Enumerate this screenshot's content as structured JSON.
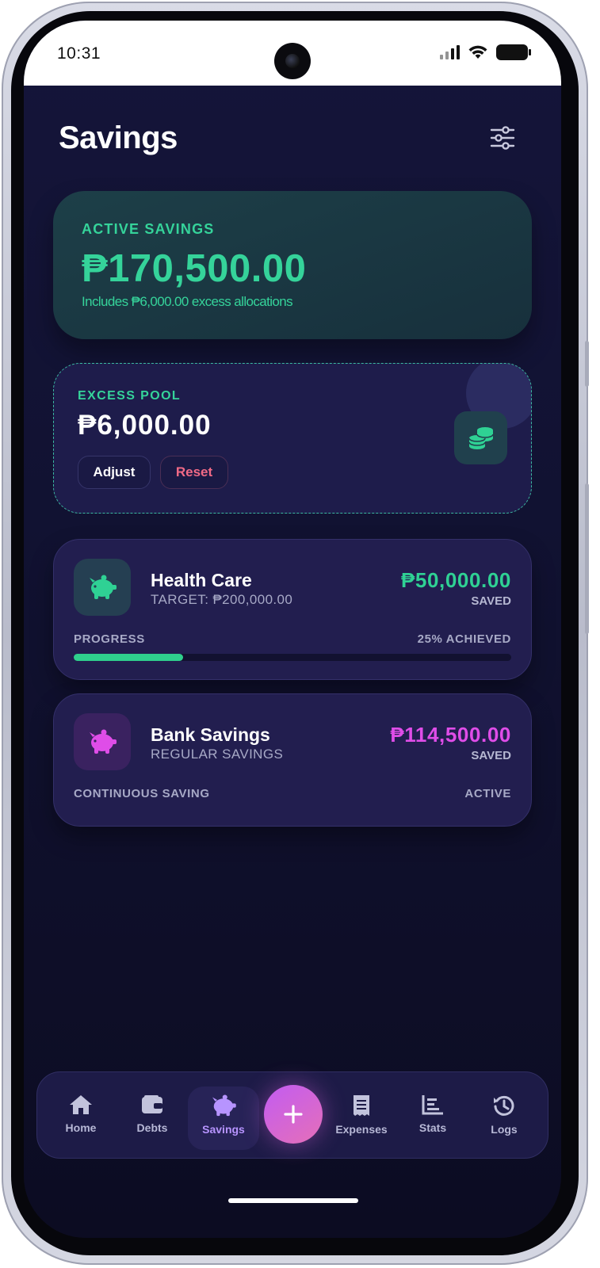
{
  "status_bar": {
    "time": "10:31"
  },
  "header": {
    "title": "Savings",
    "filter_icon": "sliders-icon"
  },
  "active_savings": {
    "label": "ACTIVE SAVINGS",
    "amount": "₱170,500.00",
    "note": "Includes ₱6,000.00 excess allocations"
  },
  "excess_pool": {
    "label": "EXCESS POOL",
    "amount": "₱6,000.00",
    "adjust_label": "Adjust",
    "reset_label": "Reset",
    "icon": "coins-icon"
  },
  "goals": [
    {
      "name": "Health Care",
      "subtitle": "TARGET: ₱200,000.00",
      "amount": "₱50,000.00",
      "saved_label": "SAVED",
      "footer_left": "PROGRESS",
      "footer_right": "25% ACHIEVED",
      "progress_percent": 25,
      "icon": "piggy-bank-icon",
      "color": "#2fd194"
    },
    {
      "name": "Bank Savings",
      "subtitle": "REGULAR SAVINGS",
      "amount": "₱114,500.00",
      "saved_label": "SAVED",
      "footer_left": "CONTINUOUS SAVING",
      "footer_right": "ACTIVE",
      "icon": "piggy-bank-icon",
      "color": "#df4de8"
    }
  ],
  "bottom_nav": {
    "items": [
      {
        "label": "Home",
        "icon": "home-icon"
      },
      {
        "label": "Debts",
        "icon": "wallet-icon"
      },
      {
        "label": "Savings",
        "icon": "piggy-bank-icon",
        "active": true
      },
      {
        "label": "Expenses",
        "icon": "receipt-icon"
      },
      {
        "label": "Stats",
        "icon": "stats-icon"
      },
      {
        "label": "Logs",
        "icon": "history-icon"
      }
    ],
    "add_icon": "plus-icon"
  },
  "colors": {
    "accent_green": "#35d39a",
    "accent_pink": "#df4de8",
    "reset_red": "#f06a86",
    "nav_active": "#b794ff"
  }
}
